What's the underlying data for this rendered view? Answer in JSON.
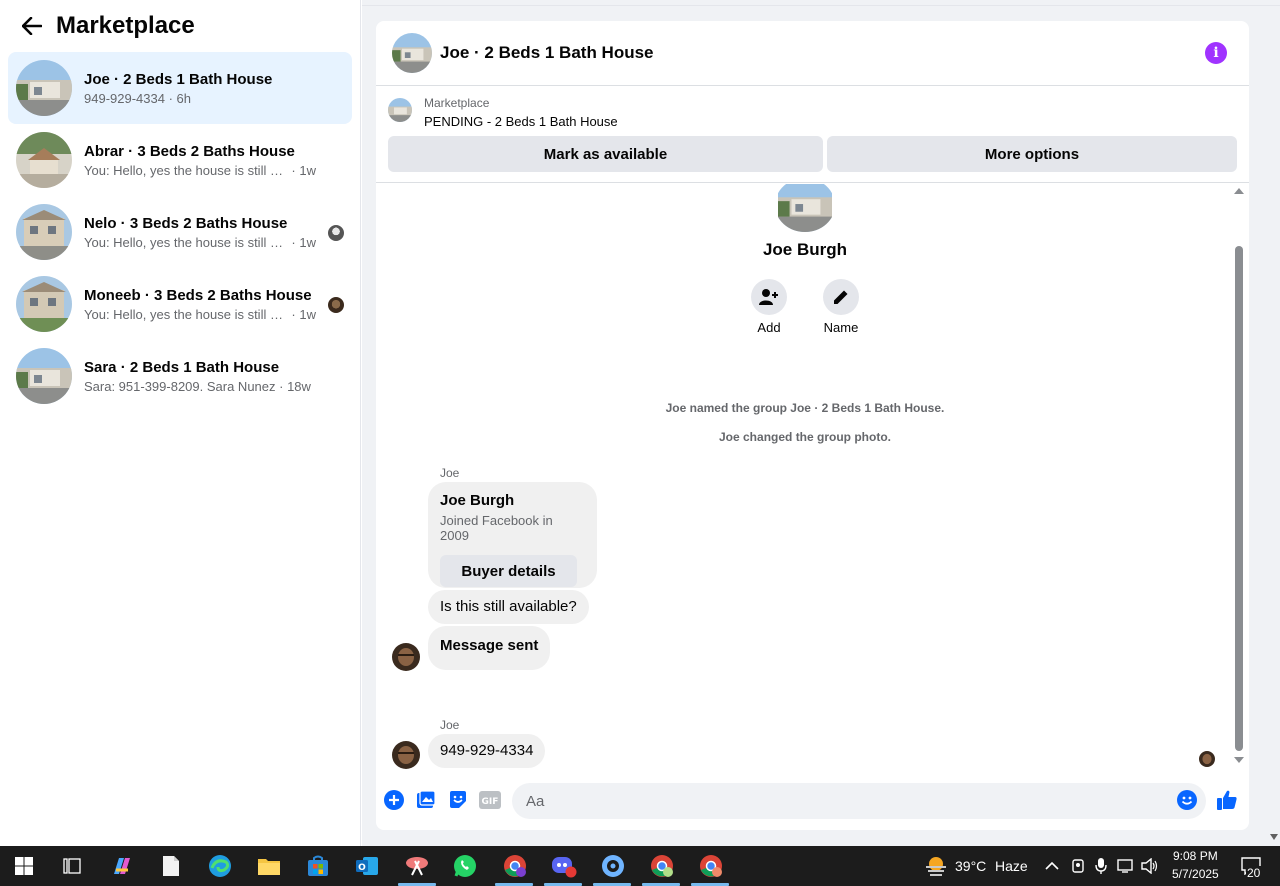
{
  "sidebar": {
    "title": "Marketplace",
    "conversations": [
      {
        "title": "Joe · 2 Beds 1 Bath House",
        "preview": "949-929-4334",
        "time": "6h",
        "active": true
      },
      {
        "title": "Abrar · 3 Beds 2 Baths House",
        "preview": "You: Hello, yes the house is still availa...",
        "time": "1w",
        "active": false
      },
      {
        "title": "Nelo · 3 Beds 2 Baths House",
        "preview": "You: Hello, yes the house is still ava...",
        "time": "1w",
        "active": false
      },
      {
        "title": "Moneeb · 3 Beds 2 Baths House",
        "preview": "You: Hello, yes the house is still ava...",
        "time": "1w",
        "active": false
      },
      {
        "title": "Sara · 2 Beds 1 Bath House",
        "preview": "Sara: 951-399-8209. Sara Nunez",
        "time": "18w",
        "active": false
      }
    ]
  },
  "chat": {
    "title": "Joe · 2 Beds 1 Bath House",
    "marketplace_label": "Marketplace",
    "listing_status": "PENDING - 2 Beds 1 Bath House",
    "mark_available_label": "Mark as available",
    "more_options_label": "More options",
    "group_name": "Joe Burgh",
    "actions": [
      {
        "label": "Add",
        "icon": "add-person-icon"
      },
      {
        "label": "Name",
        "icon": "pencil-icon"
      }
    ],
    "system_messages": [
      "Joe named the group Joe · 2 Beds 1 Bath House.",
      "Joe changed the group photo."
    ],
    "sender_1": "Joe",
    "card": {
      "title": "Joe Burgh",
      "subtitle": "Joined Facebook in 2009",
      "button": "Buyer details"
    },
    "message_1": "Is this still available?",
    "message_2": "Message sent",
    "sender_2": "Joe",
    "message_3": "949-929-4334",
    "composer_placeholder": "Aa"
  },
  "taskbar": {
    "weather_temp": "39°C",
    "weather_desc": "Haze",
    "time": "9:08 PM",
    "date": "5/7/2025",
    "notification_count": "20"
  },
  "colors": {
    "accent": "#0866ff",
    "active_bg": "#e7f3ff",
    "info": "#a033ff",
    "bubble": "#f0f0f0"
  }
}
